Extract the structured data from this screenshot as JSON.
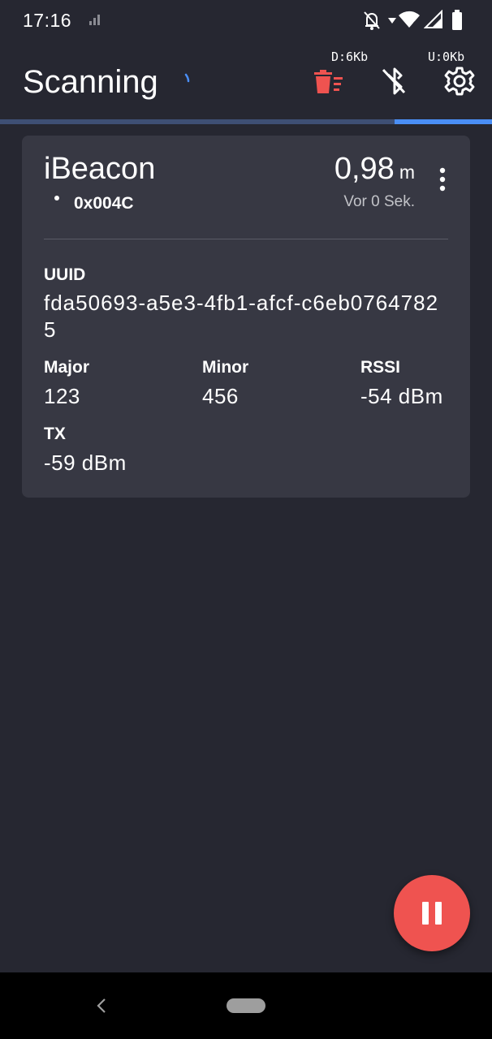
{
  "status_bar": {
    "time": "17:16",
    "icons": [
      "signal-small-icon",
      "notifications-off-icon",
      "data-arrow-icon",
      "wifi-icon",
      "cell-signal-icon",
      "battery-icon"
    ]
  },
  "app_bar": {
    "title": "Scanning",
    "traffic_down": "D:6Kb",
    "traffic_up": "U:0Kb",
    "actions": [
      "clear-list-icon",
      "bluetooth-off-icon",
      "gear-icon"
    ]
  },
  "colors": {
    "background": "#262731",
    "card": "#373843",
    "accent_red": "#ef5350",
    "progress_blue": "#4a8ef5"
  },
  "scan_progress": 0.2,
  "beacon": {
    "type": "iBeacon",
    "company_id": "0x004C",
    "distance_value": "0,98",
    "distance_unit": "m",
    "last_seen": "Vor 0 Sek.",
    "uuid_label": "UUID",
    "uuid": "fda50693-a5e3-4fb1-afcf-c6eb07647825",
    "major_label": "Major",
    "major": "123",
    "minor_label": "Minor",
    "minor": "456",
    "rssi_label": "RSSI",
    "rssi": "-54 dBm",
    "tx_label": "TX",
    "tx": "-59 dBm"
  },
  "fab": {
    "icon": "pause-icon"
  },
  "nav": {
    "icons": [
      "back-icon",
      "home-pill-icon"
    ]
  }
}
